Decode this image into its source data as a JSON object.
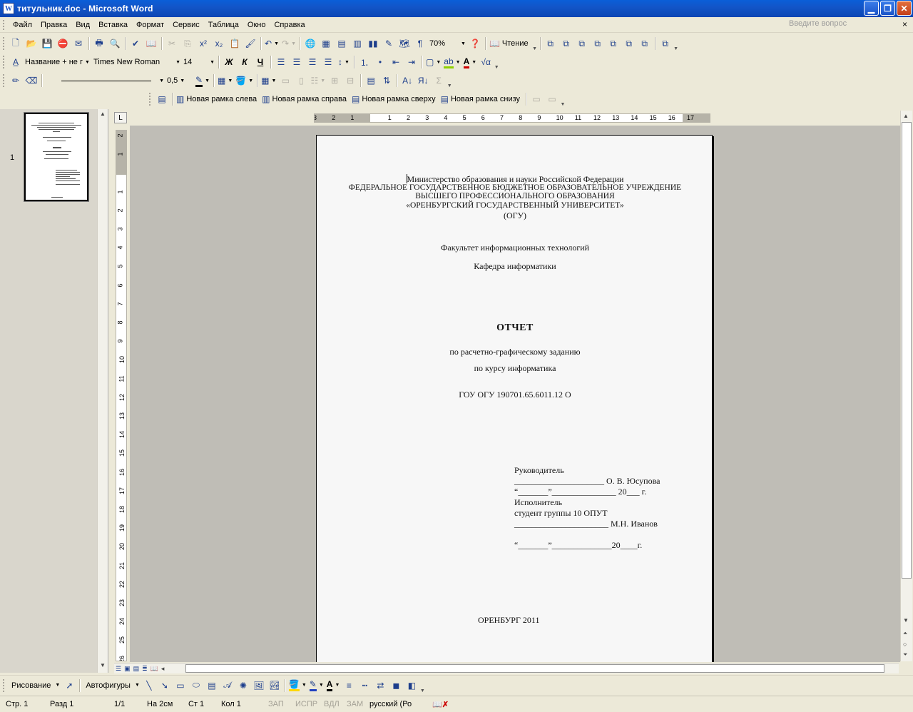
{
  "window": {
    "title": "титульник.doc - Microsoft Word",
    "app_letter": "W"
  },
  "menu": {
    "items": [
      "Файл",
      "Правка",
      "Вид",
      "Вставка",
      "Формат",
      "Сервис",
      "Таблица",
      "Окно",
      "Справка"
    ],
    "help_placeholder": "Введите вопрос",
    "close_glyph": "×"
  },
  "toolbar_standard": {
    "zoom": "70%",
    "reading_label": "Чтение"
  },
  "toolbar_formatting": {
    "style": "Название + не г",
    "font": "Times New Roman",
    "size": "14",
    "bold": "Ж",
    "italic": "К",
    "underline": "Ч"
  },
  "toolbar_tables": {
    "line_weight": "0,5"
  },
  "toolbar_frames": {
    "left": "Новая рамка слева",
    "right": "Новая рамка справа",
    "top": "Новая рамка сверху",
    "bottom": "Новая рамка снизу"
  },
  "thumbnail": {
    "page_number": "1"
  },
  "ruler": {
    "tab_marker": "L",
    "h_labels": [
      "3",
      "2",
      "1",
      "",
      "1",
      "2",
      "3",
      "4",
      "5",
      "6",
      "7",
      "8",
      "9",
      "10",
      "11",
      "12",
      "13",
      "14",
      "15",
      "16",
      "17"
    ],
    "v_labels": [
      "2",
      "1",
      "",
      "1",
      "2",
      "3",
      "4",
      "5",
      "6",
      "7",
      "8",
      "9",
      "10",
      "11",
      "12",
      "13",
      "14",
      "15",
      "16",
      "17",
      "18",
      "19",
      "20",
      "21",
      "22",
      "23",
      "24",
      "25",
      "26"
    ]
  },
  "document": {
    "line1": "Министерство образования и науки Российской Федерации",
    "line2": "ФЕДЕРАЛЬНОЕ ГОСУДАРСТВЕННОЕ БЮДЖЕТНОЕ ОБРАЗОВАТЕЛЬНОЕ УЧРЕЖДЕНИЕ",
    "line3": "ВЫСШЕГО ПРОФЕССИОНАЛЬНОГО ОБРАЗОВАНИЯ",
    "line4": "«ОРЕНБУРГСКИЙ ГОСУДАРСТВЕННЫЙ УНИВЕРСИТЕТ»",
    "line5": "(ОГУ)",
    "faculty": "Факультет информационных технологий",
    "department": "Кафедра  информатики",
    "report_title": "ОТЧЕТ",
    "subtitle1": "по расчетно-графическому заданию",
    "subtitle2": "по курсу информатика",
    "code": "ГОУ ОГУ 190701.65.6011.12 О",
    "supervisor_label": "Руководитель",
    "supervisor_line": "_____________________ О. В. Юсупова",
    "supervisor_date": "“_______”_______________ 20___ г.",
    "executor_label": "Исполнитель",
    "executor_group": "студент группы 10 ОПУТ",
    "executor_line": "______________________  М.Н. Иванов",
    "executor_date": "“_______”______________20____г.",
    "city_year": "ОРЕНБУРГ 2011"
  },
  "drawing_toolbar": {
    "draw_label": "Рисование",
    "autoshapes_label": "Автофигуры"
  },
  "status": {
    "page": "Стр.  1",
    "section": "Разд  1",
    "pages": "1/1",
    "at": "На  2см",
    "line": "Ст  1",
    "col": "Кол  1",
    "rec": "ЗАП",
    "trk": "ИСПР",
    "ext": "ВДЛ",
    "ovr": "ЗАМ",
    "language": "русский (Ро"
  }
}
